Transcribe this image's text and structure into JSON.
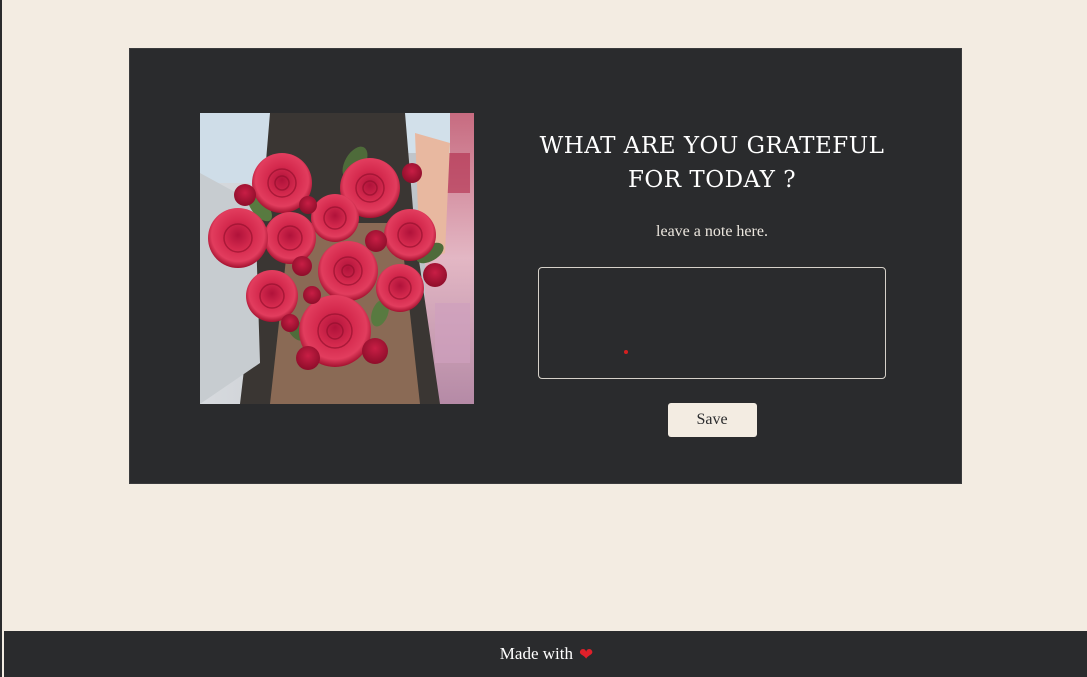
{
  "card": {
    "title": "WHAT ARE YOU GRATEFUL FOR TODAY ?",
    "subtitle": "leave a note here.",
    "note": {
      "value": "",
      "placeholder": ""
    },
    "save_label": "Save",
    "photo_alt": "Bouquet of red roses"
  },
  "footer": {
    "text": "Made with",
    "icon": "heart-icon"
  },
  "colors": {
    "background": "#f3ece2",
    "card": "#2a2b2d",
    "accent": "#e0202a"
  }
}
